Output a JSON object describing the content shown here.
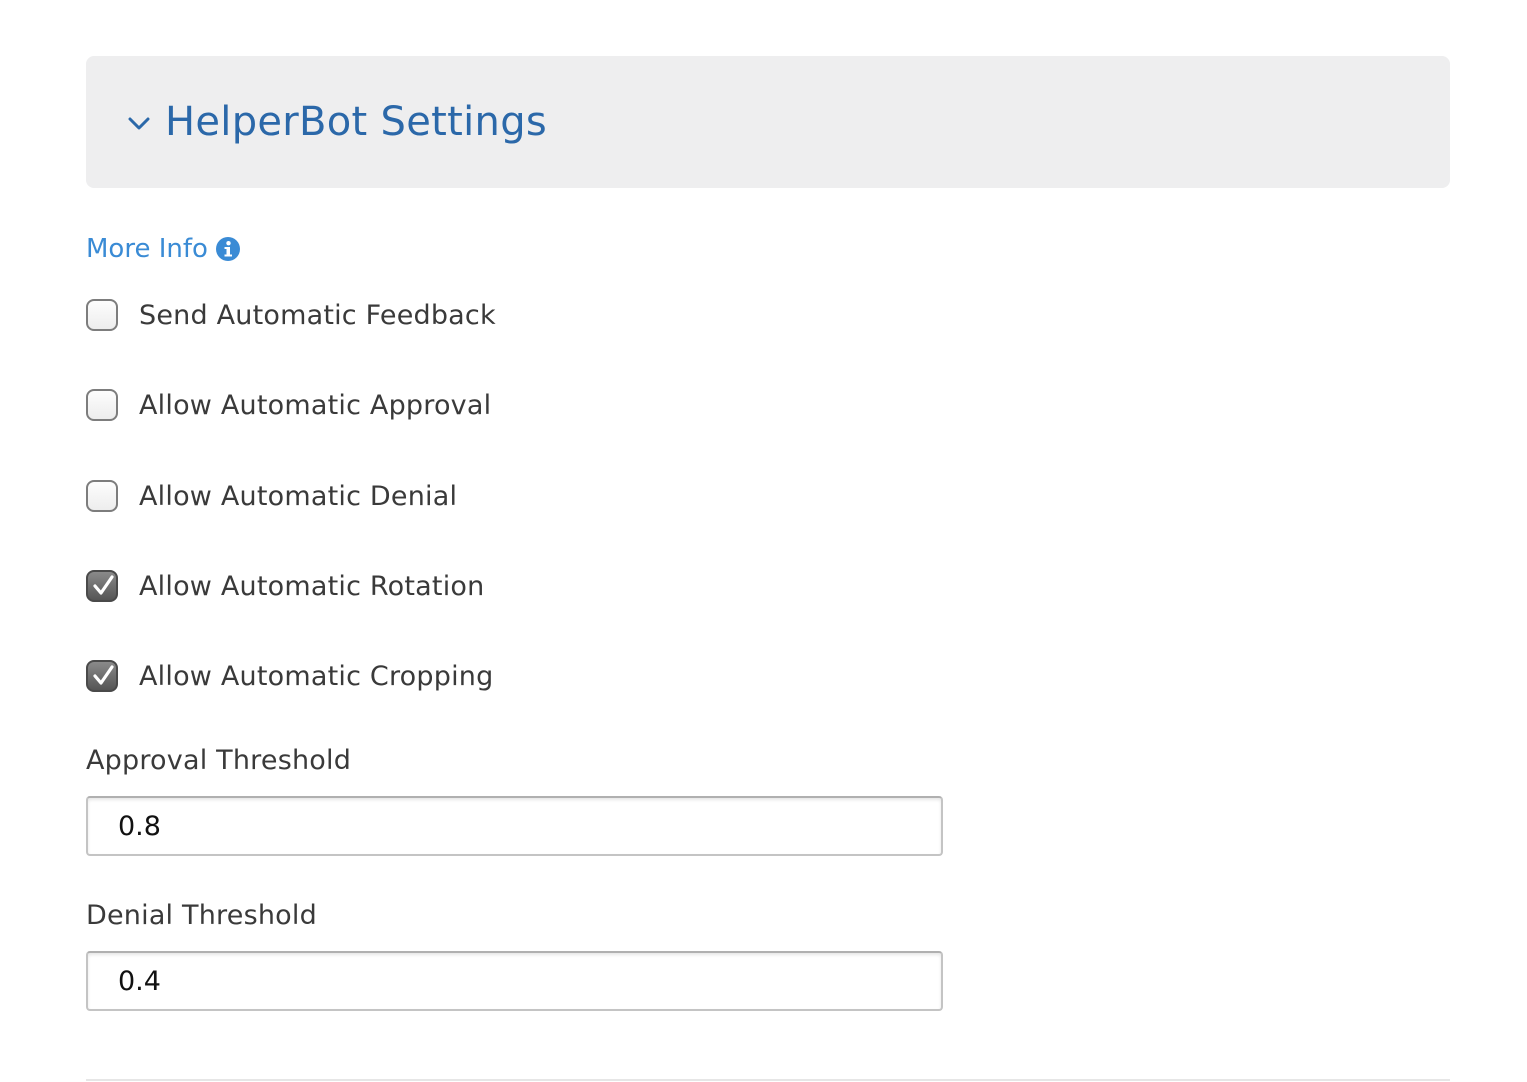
{
  "panel": {
    "title": "HelperBot Settings",
    "expanded": true,
    "title_color": "#2b68a9"
  },
  "more_info": {
    "label": "More Info",
    "icon": "info-circle-icon",
    "color": "#3a8bd5"
  },
  "options": [
    {
      "label": "Send Automatic Feedback",
      "checked": false
    },
    {
      "label": "Allow Automatic Approval",
      "checked": false
    },
    {
      "label": "Allow Automatic Denial",
      "checked": false
    },
    {
      "label": "Allow Automatic Rotation",
      "checked": true
    },
    {
      "label": "Allow Automatic Cropping",
      "checked": true
    }
  ],
  "fields": {
    "approval_threshold": {
      "label": "Approval Threshold",
      "value": "0.8"
    },
    "denial_threshold": {
      "label": "Denial Threshold",
      "value": "0.4"
    }
  }
}
